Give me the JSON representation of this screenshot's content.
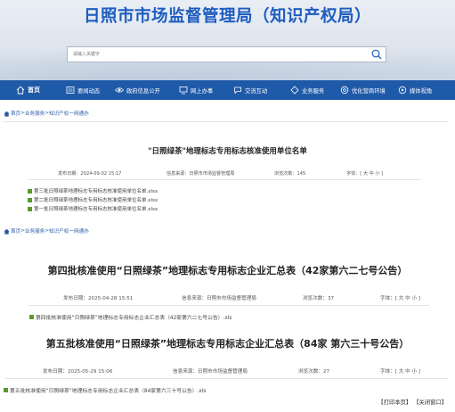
{
  "site": {
    "title": "日照市市场监督管理局（知识产权局）"
  },
  "search": {
    "placeholder": "请输入关键字"
  },
  "nav": {
    "items": [
      {
        "label": "首页",
        "icon": "home-icon"
      },
      {
        "label": "要闻动态",
        "icon": "news-icon"
      },
      {
        "label": "政府信息公开",
        "icon": "eye-icon"
      },
      {
        "label": "网上办事",
        "icon": "monitor-icon"
      },
      {
        "label": "交流互动",
        "icon": "chat-icon"
      },
      {
        "label": "业务服务",
        "icon": "diamond-icon"
      },
      {
        "label": "优化营商环境",
        "icon": "settings-icon"
      },
      {
        "label": "媒体视角",
        "icon": "media-icon"
      }
    ]
  },
  "breadcrumb1": {
    "home": "首页",
    "sep1": ">",
    "section": "业务服务",
    "sep2": ">",
    "sub": "知识产权一网通办"
  },
  "article1": {
    "title": "\"日照绿茶\"地理标志专用标志核准使用单位名单",
    "date_label": "发布日期：",
    "date": "2024-09-02  15:17",
    "source_label": "信息来源：",
    "source": "日照市市场监督管理局",
    "views_label": "浏览次数：",
    "views": "145",
    "font_label": "字体：[ 大 中 小 ]",
    "attachments": [
      "第三批日照绿茶地理标志专用标志核准使用单位名单.xlsx",
      "第二批日照绿茶地理标志专用标志核准使用单位名单.xlsx",
      "第一批日照绿茶地理标志专用标志核准使用单位名单.xlsx"
    ]
  },
  "breadcrumb2": {
    "home": "首页",
    "sep1": ">",
    "section": "业务服务",
    "sep2": ">",
    "sub": "知识产权一网通办"
  },
  "article2": {
    "title": "第四批核准使用“日照绿茶”地理标志专用标志企业汇总表（42家第六二七号公告）",
    "date_label": "发布日期：",
    "date": "2025-04-28  15:51",
    "source_label": "信息来源：",
    "source": "日照市市场监督管理局",
    "views_label": "浏览次数：",
    "views": "37",
    "font_label": "字体：[ 大 中 小 ]",
    "attachments": [
      "第四批核准使用“日照绿茶”地理标志专用标志企业汇总表（42家第六二七号公告）.xls"
    ]
  },
  "article3": {
    "title": "第五批核准使用“日照绿茶”地理标志专用标志企业汇总表（84家 第六三十号公告）",
    "date_label": "发布日期：",
    "date": "2025-05-29  15:06",
    "source_label": "信息来源：",
    "source": "日照市市场监督管理局",
    "views_label": "浏览次数：",
    "views": "27",
    "font_label": "字体：[ 大 中 小 ]",
    "attachments": [
      "第五批核准使用“日照绿茶”地理标志专用标志企业汇总表（84家第六三十号公告）.xls"
    ]
  },
  "footer": {
    "print": "【打印本页】",
    "close": "【关闭窗口】"
  },
  "colors": {
    "brand": "#1e5cbf",
    "nav_bg": "#1f5aa8",
    "file_icon": "#5a9a2e"
  }
}
